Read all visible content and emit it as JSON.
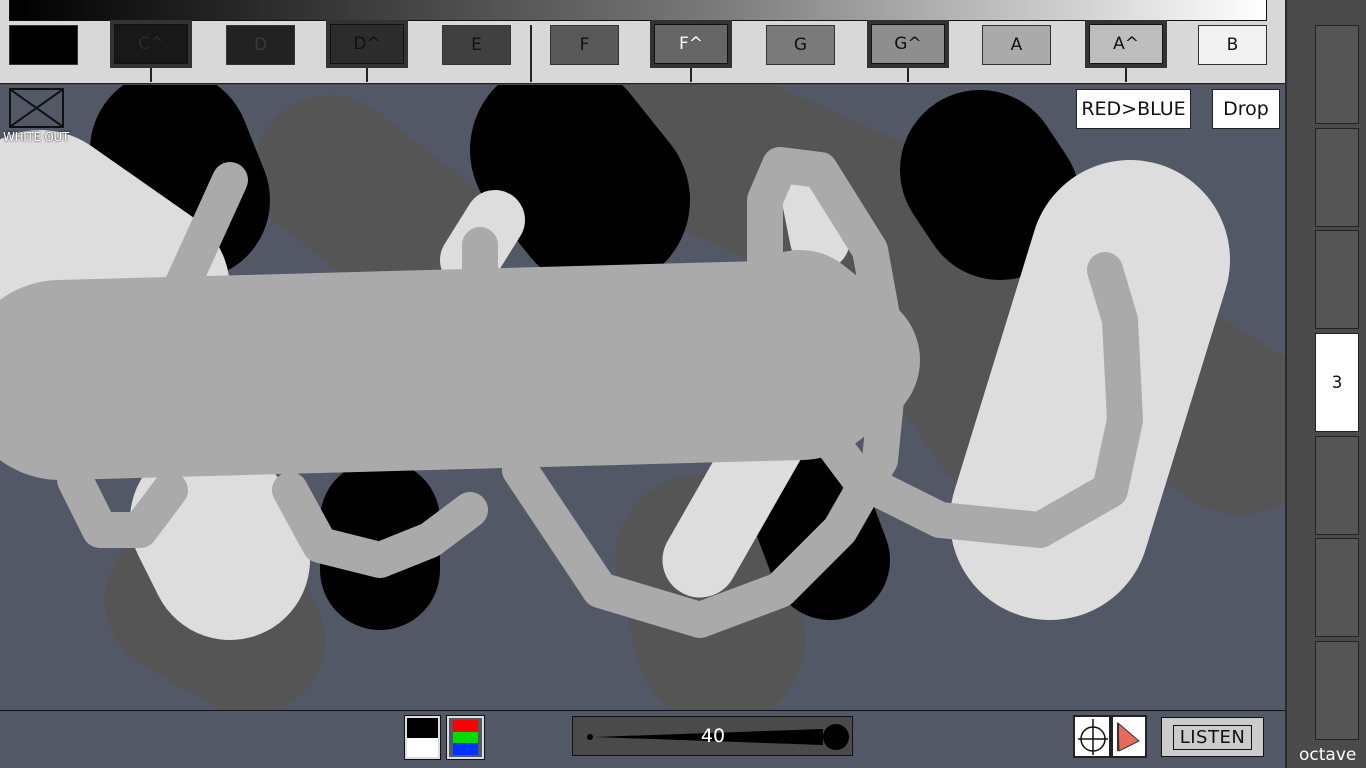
{
  "palette": {
    "keys": [
      {
        "label": "",
        "color": "#000000",
        "sharp": false,
        "text_color": "#222"
      },
      {
        "label": "C^",
        "color": "#181818",
        "sharp": true,
        "text_color": "#2a2a2a"
      },
      {
        "label": "D",
        "color": "#222222",
        "sharp": false,
        "text_color": "#3a3a3a"
      },
      {
        "label": "D^",
        "color": "#2c2c2c",
        "sharp": true,
        "text_color": "#111"
      },
      {
        "label": "E",
        "color": "#404040",
        "sharp": false,
        "text_color": "#111"
      },
      {
        "label": "F",
        "color": "#585858",
        "sharp": false,
        "text_color": "#111"
      },
      {
        "label": "F^",
        "color": "#666666",
        "sharp": true,
        "text_color": "#fff"
      },
      {
        "label": "G",
        "color": "#7a7a7a",
        "sharp": false,
        "text_color": "#111"
      },
      {
        "label": "G^",
        "color": "#8e8e8e",
        "sharp": true,
        "text_color": "#111"
      },
      {
        "label": "A",
        "color": "#aaaaaa",
        "sharp": false,
        "text_color": "#111"
      },
      {
        "label": "A^",
        "color": "#bdbdbd",
        "sharp": true,
        "text_color": "#111"
      },
      {
        "label": "B",
        "color": "#f2f2f2",
        "sharp": false,
        "text_color": "#111"
      }
    ]
  },
  "overlay": {
    "white_out_label": "WHITE OUT",
    "mode_button": "RED>BLUE",
    "drop_button": "Drop"
  },
  "bottom": {
    "brush_size": "40",
    "listen_label": "LISTEN",
    "rgb_colors": [
      "#ff0000",
      "#00dd00",
      "#0033ff"
    ]
  },
  "octaves": {
    "items": [
      "",
      "",
      "",
      "3",
      "",
      "",
      ""
    ],
    "active_index": 3,
    "label": "octave"
  },
  "colors": {
    "canvas_bg": "#525866",
    "black": "#000000",
    "dark_gray": "#555555",
    "mid_gray": "#aaaaaa",
    "light_gray": "#dddddd"
  }
}
